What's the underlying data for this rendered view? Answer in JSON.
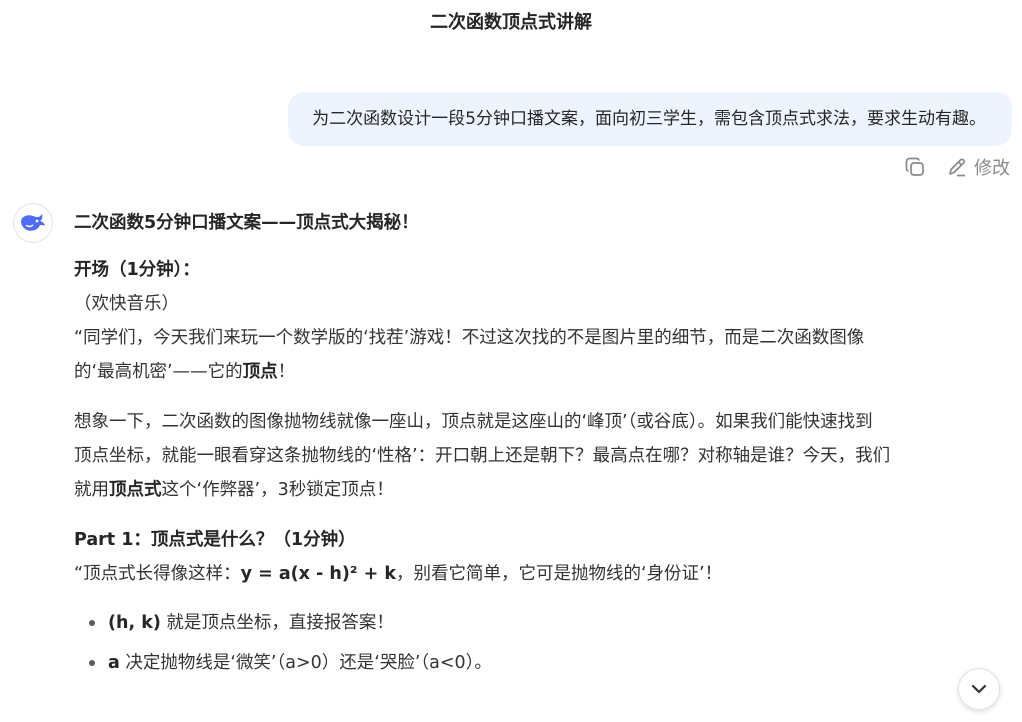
{
  "chat": {
    "title": "二次函数顶点式讲解"
  },
  "user_message": {
    "text": "为二次函数设计一段5分钟口播文案，面向初三学生，需包含顶点式求法，要求生动有趣。",
    "actions": {
      "copy_icon": "copy-icon",
      "edit_label": "修改"
    }
  },
  "assistant": {
    "avatar_icon": "whale-logo-icon",
    "heading": "二次函数5分钟口播文案——顶点式大揭秘！",
    "opening": {
      "heading": "开场（1分钟）：",
      "line1": "（欢快音乐）",
      "line2": "“同学们，今天我们来玩一个数学版的‘找茬’游戏！不过这次找的不是图片里的细节，而是二次函数图像",
      "line3_pre": "的‘最高机密’——它的",
      "line3_bold": "顶点",
      "line3_post": "！"
    },
    "para2": {
      "line1": "想象一下，二次函数的图像抛物线就像一座山，顶点就是这座山的‘峰顶’（或谷底）。如果我们能快速找到",
      "line2": "顶点坐标，就能一眼看穿这条抛物线的‘性格’：开口朝上还是朝下？最高点在哪？对称轴是谁？今天，我们",
      "line3_pre": "就用",
      "line3_bold": "顶点式",
      "line3_post": "这个‘作弊器’，3秒锁定顶点！"
    },
    "part1": {
      "heading": "Part 1：顶点式是什么？（1分钟）",
      "line_pre": "“顶点式长得像这样：",
      "formula": "y = a(x - h)² + k",
      "line_post": "，别看它简单，它可是抛物线的‘身份证’！",
      "bullets": [
        {
          "bold": "(h, k)",
          "text": " 就是顶点坐标，直接报答案！"
        },
        {
          "bold": "a",
          "text": " 决定抛物线是‘微笑’（a>0）还是‘哭脸’（a<0）。"
        }
      ]
    }
  },
  "controls": {
    "scroll_down_icon": "chevron-down-icon"
  },
  "colors": {
    "user_bubble_bg": "#eef4fe",
    "accent": "#4d6bfe"
  }
}
